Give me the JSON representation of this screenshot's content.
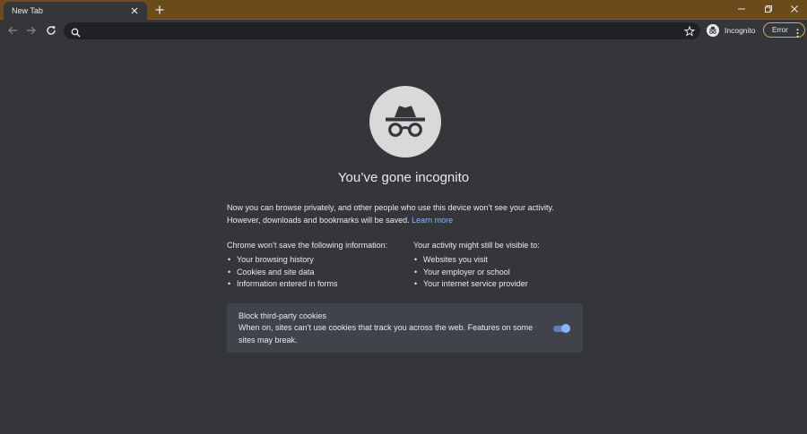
{
  "tab": {
    "title": "New Tab"
  },
  "window_controls": [
    "minimize-icon",
    "restore-icon",
    "close-icon"
  ],
  "omnibox": {
    "value": "",
    "placeholder": ""
  },
  "profile": {
    "label": "Incognito"
  },
  "error_chip": {
    "label": "Error"
  },
  "page": {
    "heading": "You’ve gone incognito",
    "intro": "Now you can browse privately, and other people who use this device won’t see your activity. However, downloads and bookmarks will be saved.",
    "learn_more": "Learn more",
    "left_column": {
      "title": "Chrome won’t save the following information:",
      "items": [
        "Your browsing history",
        "Cookies and site data",
        "Information entered in forms"
      ]
    },
    "right_column": {
      "title": "Your activity might still be visible to:",
      "items": [
        "Websites you visit",
        "Your employer or school",
        "Your internet service provider"
      ]
    },
    "cookies": {
      "title": "Block third-party cookies",
      "description": "When on, sites can’t use cookies that track you across the web. Features on some sites may break.",
      "enabled": true
    }
  },
  "colors": {
    "frame": "#6b4a1c",
    "background": "#35363a",
    "omnibox": "#202124",
    "link": "#8ab4f8",
    "card": "#41434a",
    "error_border": "#d6a54d"
  }
}
